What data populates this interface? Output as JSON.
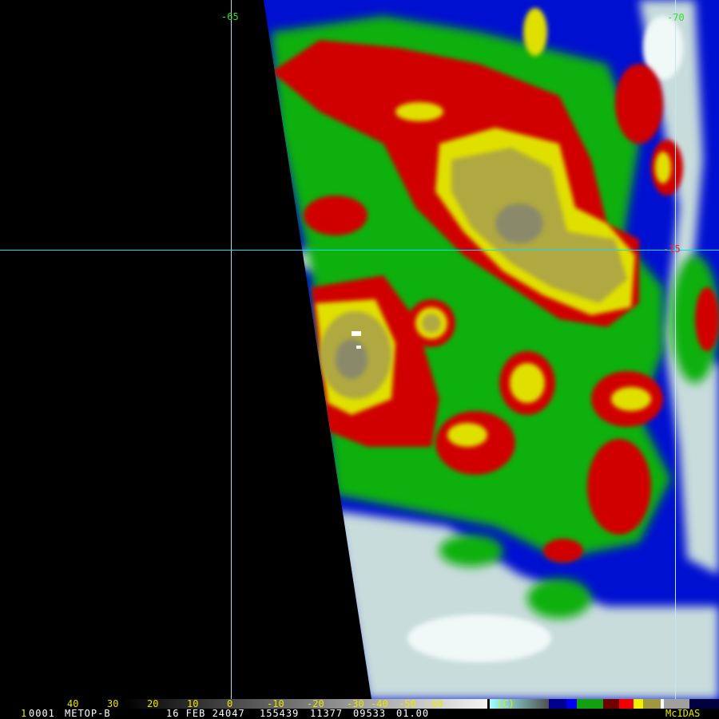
{
  "image": {
    "graticule": {
      "lon_labels": [
        "-65",
        "-70"
      ],
      "lat_labels": [
        "-15"
      ],
      "line_color": "#00e0ff"
    },
    "colors": {
      "background": "#000000",
      "cloud_blue": "#0010d0",
      "cloud_green": "#10b010",
      "cloud_red": "#d00000",
      "cloud_yellow": "#e0e000",
      "cloud_olive": "#b0a840",
      "cloud_white": "#e8f0f0",
      "label_yellow": "#e8e800",
      "label_green": "#30e030",
      "label_red": "#ff2020"
    }
  },
  "color_scale": {
    "unit": "(C)",
    "tick_labels": [
      "40",
      "30",
      "20",
      "10",
      "0",
      "-10",
      "-20",
      "-30",
      "-40",
      "-50",
      "-60"
    ]
  },
  "footer": {
    "frame_number": "1",
    "frame_id": "0001",
    "satellite": "METOP-B",
    "date": "16 FEB 24047",
    "time": "155439",
    "field1": "11377",
    "field2": "09533",
    "field3": "01.00",
    "brand": "McIDAS"
  }
}
